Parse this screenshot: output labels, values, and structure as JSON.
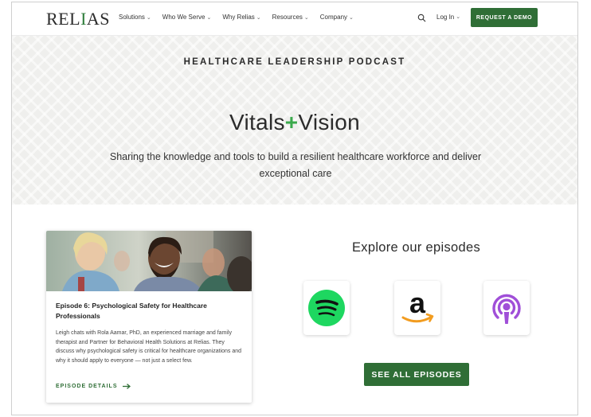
{
  "header": {
    "logo_pre": "REL",
    "logo_accent": "I",
    "logo_post": "AS",
    "nav": [
      {
        "label": "Solutions"
      },
      {
        "label": "Who We Serve"
      },
      {
        "label": "Why Relias"
      },
      {
        "label": "Resources"
      },
      {
        "label": "Company"
      }
    ],
    "login_label": "Log In",
    "demo_label": "REQUEST A DEMO"
  },
  "hero": {
    "kicker": "HEALTHCARE LEADERSHIP PODCAST",
    "title_part1": "Vitals",
    "title_plus": "+",
    "title_part2": "Vision",
    "subtitle": "Sharing the knowledge and tools to build a resilient healthcare workforce and deliver exceptional care"
  },
  "episode": {
    "title": "Episode 6: Psychological Safety for Healthcare Professionals",
    "description": "Leigh chats with Rola Aamar, PhD, an experienced marriage and family therapist and Partner for Behavioral Health Solutions at Relias. They discuss why psychological safety is critical for healthcare organizations and why it should apply to everyone — not just a select few.",
    "link_label": "EPISODE DETAILS"
  },
  "explore": {
    "title": "Explore our episodes",
    "platforms": [
      {
        "icon": "spotify-icon"
      },
      {
        "icon": "amazon-icon"
      },
      {
        "icon": "apple-podcasts-icon"
      }
    ],
    "see_all_label": "SEE ALL EPISODES"
  },
  "colors": {
    "brand_green": "#2f6e36",
    "plus_green": "#3aa94b",
    "spotify_green": "#1ed760",
    "podcasts_purple": "#a04fd8"
  }
}
